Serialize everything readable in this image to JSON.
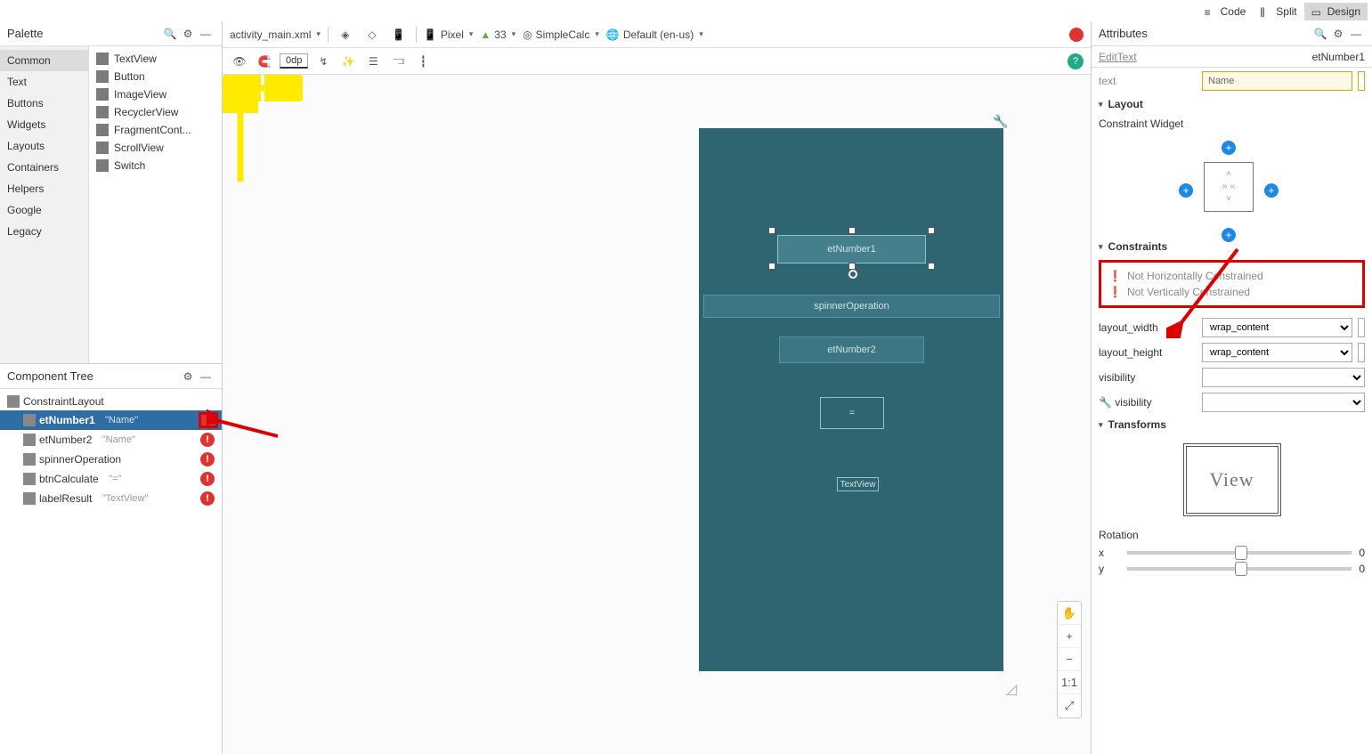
{
  "modeTabs": {
    "code": "Code",
    "split": "Split",
    "design": "Design"
  },
  "palette": {
    "title": "Palette",
    "categories": [
      "Common",
      "Text",
      "Buttons",
      "Widgets",
      "Layouts",
      "Containers",
      "Helpers",
      "Google",
      "Legacy"
    ],
    "items": [
      "TextView",
      "Button",
      "ImageView",
      "RecyclerView",
      "FragmentCont...",
      "ScrollView",
      "Switch"
    ]
  },
  "componentTree": {
    "title": "Component Tree",
    "root": "ConstraintLayout",
    "items": [
      {
        "id": "etNumber1",
        "extra": "\"Name\"",
        "selected": true,
        "err": true
      },
      {
        "id": "etNumber2",
        "extra": "\"Name\"",
        "err": true
      },
      {
        "id": "spinnerOperation",
        "extra": "",
        "err": true
      },
      {
        "id": "btnCalculate",
        "extra": "\"=\"",
        "err": true
      },
      {
        "id": "labelResult",
        "extra": "\"TextView\"",
        "err": true
      }
    ]
  },
  "cfg": {
    "file": "activity_main.xml",
    "device": "Pixel",
    "api": "33",
    "theme": "SimpleCalc",
    "locale": "Default (en-us)"
  },
  "toolbar": {
    "dp": "0dp"
  },
  "design": {
    "et1": "etNumber1",
    "spinner": "spinnerOperation",
    "et2": "etNumber2",
    "btn": "=",
    "tv": "TextView"
  },
  "attributes": {
    "title": "Attributes",
    "type": "EditText",
    "selected": "etNumber1",
    "textRow": {
      "label": "text",
      "value": "Name"
    },
    "layoutSection": "Layout",
    "cwLabel": "Constraint Widget",
    "constraintsSection": "Constraints",
    "err1": "Not Horizontally Constrained",
    "err2": "Not Vertically Constrained",
    "layout_width_label": "layout_width",
    "layout_width": "wrap_content",
    "layout_height_label": "layout_height",
    "layout_height": "wrap_content",
    "visibility_label": "visibility",
    "tool_visibility_label": "visibility",
    "transforms": "Transforms",
    "viewText": "View",
    "rotation": "Rotation",
    "x": "x",
    "xv": "0",
    "y": "y",
    "yv": "0"
  },
  "zoom": [
    "✋",
    "+",
    "−",
    "1:1",
    "⤢"
  ]
}
